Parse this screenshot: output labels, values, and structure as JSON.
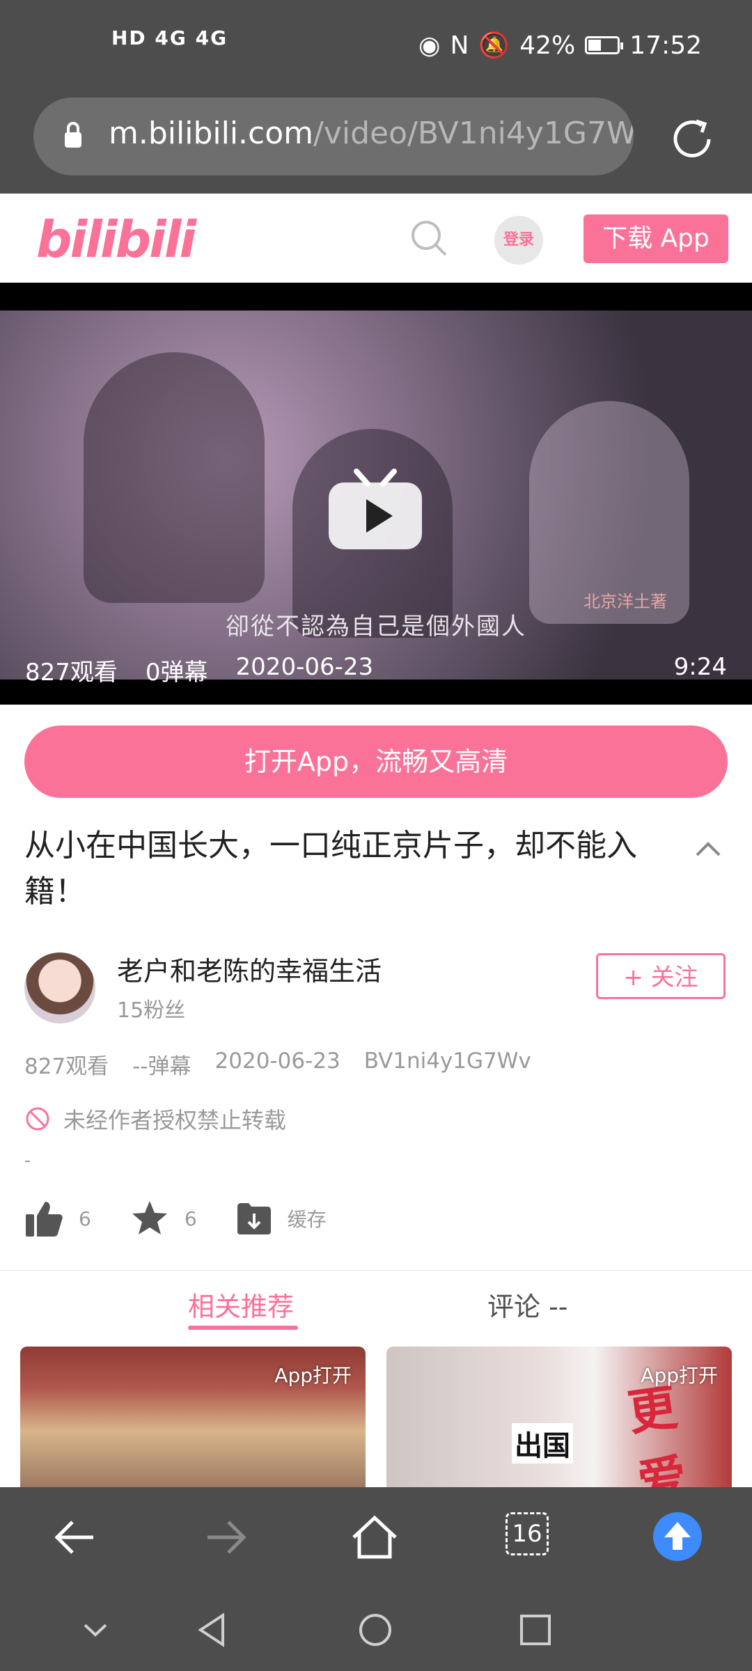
{
  "status": {
    "network": "HD 4G 4G",
    "battery": "42%",
    "time": "17:52"
  },
  "browser": {
    "url_domain": "m.bilibili.com",
    "url_path": "/video/BV1ni4y1G7W",
    "tab_count": "16"
  },
  "header": {
    "logo": "bilibili",
    "login_label": "登录",
    "download_label": "下载 App"
  },
  "player": {
    "subtitle": "卻從不認為自己是個外國人",
    "watermark": "北京洋土著",
    "views": "827观看",
    "danmaku": "0弹幕",
    "date": "2020-06-23",
    "duration": "9:24"
  },
  "open_app_label": "打开App，流畅又高清",
  "video": {
    "title": "从小在中国长大，一口纯正京片子，却不能入籍！",
    "uploader_name": "老户和老陈的幸福生活",
    "uploader_fans": "15粉丝",
    "follow_label": "+ 关注",
    "meta": {
      "views": "827观看",
      "danmaku": "--弹幕",
      "date": "2020-06-23",
      "bvid": "BV1ni4y1G7Wv"
    },
    "copyright_notice": "未经作者授权禁止转载",
    "description": "-",
    "likes": "6",
    "favorites": "6",
    "cache_label": "缓存"
  },
  "tabs": {
    "related": "相关推荐",
    "comments": "评论 --"
  },
  "recommendations": [
    {
      "badge": "App打开"
    },
    {
      "badge": "App打开",
      "overlay_left": "出国",
      "overlay_right": "更爱国"
    }
  ],
  "colors": {
    "brand_pink": "#fb7299",
    "chrome_gray": "#4d4d4d",
    "accent_blue": "#3d8bfd"
  }
}
